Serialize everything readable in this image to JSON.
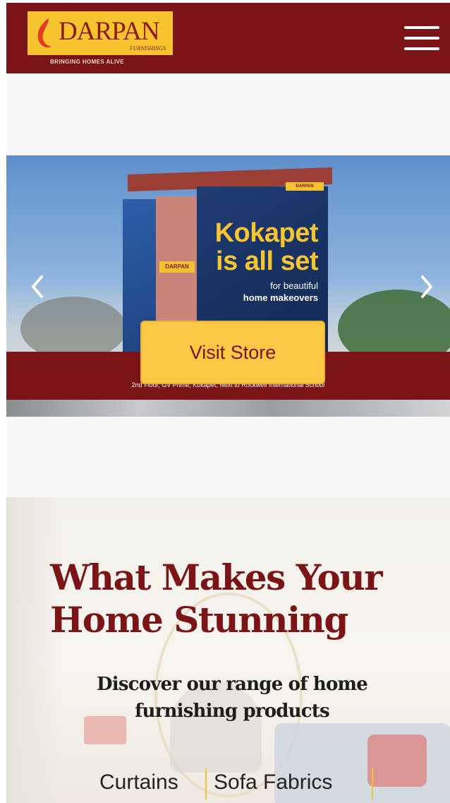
{
  "header": {
    "logo_text": "DARPAN",
    "logo_subtext": "FURNISHINGS",
    "tagline": "BRINGING HOMES ALIVE"
  },
  "slider": {
    "mini_sign": "DARPAN",
    "building_sign": "DARPAN",
    "promo_line1": "Kokapet",
    "promo_line2": "is all set",
    "promo_sub1": "for beautiful",
    "promo_sub2": "home makeovers",
    "address": "2nd Floor, GV Prime, Kokapet, Next to Rockwell International School",
    "cta_label": "Visit Store"
  },
  "section": {
    "title_line1": "What Makes Your",
    "title_line2": "Home Stunning",
    "subtitle": "Discover our range of home furnishing products",
    "categories": [
      "Curtains",
      "Sofa Fabrics"
    ]
  },
  "colors": {
    "brand_maroon": "#7a1416",
    "brand_yellow": "#fcc845",
    "text_dark": "#222222"
  }
}
